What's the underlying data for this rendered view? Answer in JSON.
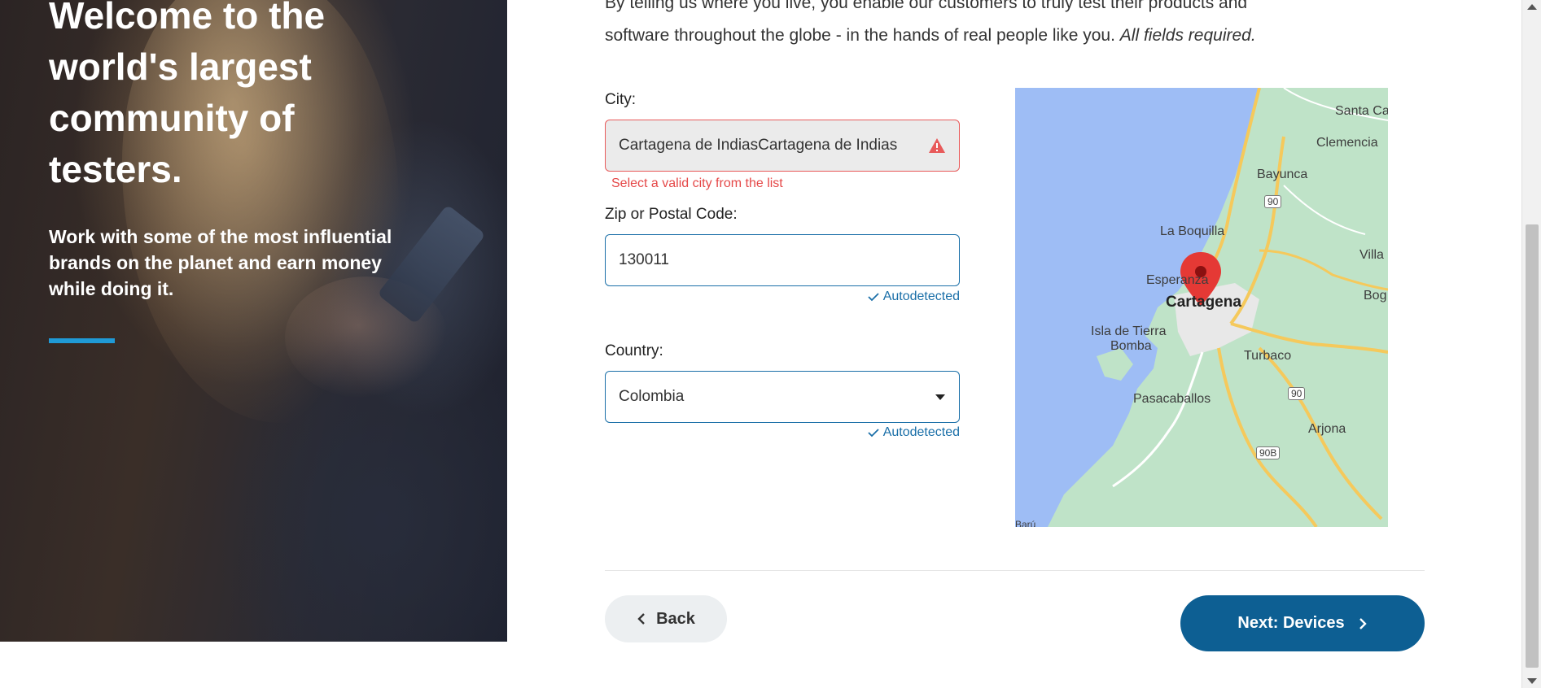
{
  "hero": {
    "title": "Welcome to the world's largest community of testers.",
    "subtitle": "Work with some of the most influential brands on the planet and earn money while doing it.",
    "accent_color": "#1f9ad6"
  },
  "intro": {
    "line1": "By telling us where you live, you enable our customers to truly test their products and",
    "line2": "software throughout the globe - in the hands of real people like you.",
    "required": "All fields required."
  },
  "form": {
    "city": {
      "label": "City:",
      "value": "Cartagena de IndiasCartagena de Indias",
      "error": "Select a valid city from the list",
      "icon": "warning-icon"
    },
    "zip": {
      "label": "Zip or Postal Code:",
      "value": "130011",
      "status": "Autodetected"
    },
    "country": {
      "label": "Country:",
      "value": "Colombia",
      "status": "Autodetected"
    }
  },
  "map": {
    "labels": {
      "santa_ca": "Santa Ca",
      "clemencia": "Clemencia",
      "bayunca": "Bayunca",
      "r90a": "90",
      "la_boquilla": "La Boquilla",
      "villa": "Villa",
      "esperanza": "Esperanza",
      "cartagena": "Cartagena",
      "bog": "Bog",
      "isla1": "Isla de Tierra",
      "isla2": "Bomba",
      "turbaco": "Turbaco",
      "pasacaballos": "Pasacaballos",
      "r90b": "90",
      "arjona": "Arjona",
      "r90b2": "90B",
      "baru": "Barú"
    }
  },
  "nav": {
    "back_label": "Back",
    "next_label": "Next: Devices"
  },
  "colors": {
    "primary": "#0d5f93",
    "error": "#e54848",
    "link": "#1a6fa8"
  }
}
